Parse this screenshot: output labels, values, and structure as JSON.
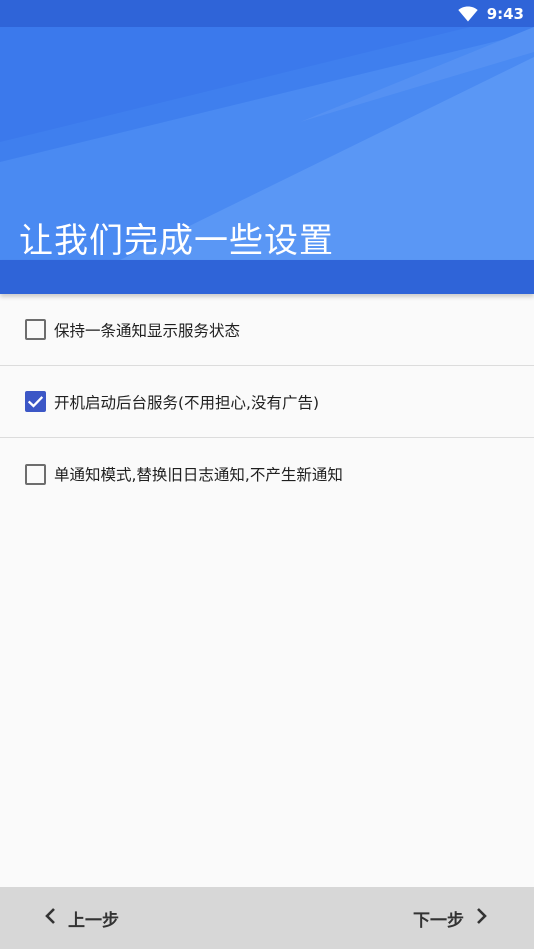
{
  "status_bar": {
    "time": "9:43",
    "icons": [
      "wifi-icon"
    ]
  },
  "header": {
    "title": "让我们完成一些设置"
  },
  "options": [
    {
      "label": "保持一条通知显示服务状态",
      "checked": false
    },
    {
      "label": "开机启动后台服务(不用担心,没有广告)",
      "checked": true
    },
    {
      "label": "单通知模式,替换旧日志通知,不产生新通知",
      "checked": false
    }
  ],
  "navigation": {
    "prev_label": "上一步",
    "next_label": "下一步",
    "prev_icon": "chevron-left-icon",
    "next_icon": "chevron-right-icon"
  },
  "colors": {
    "header_blue": "#4a8af2",
    "header_dark": "#2f64d8",
    "checkbox_checked": "#3c57c6",
    "bottom_bar": "#d7d7d7",
    "background": "#fafafa"
  }
}
